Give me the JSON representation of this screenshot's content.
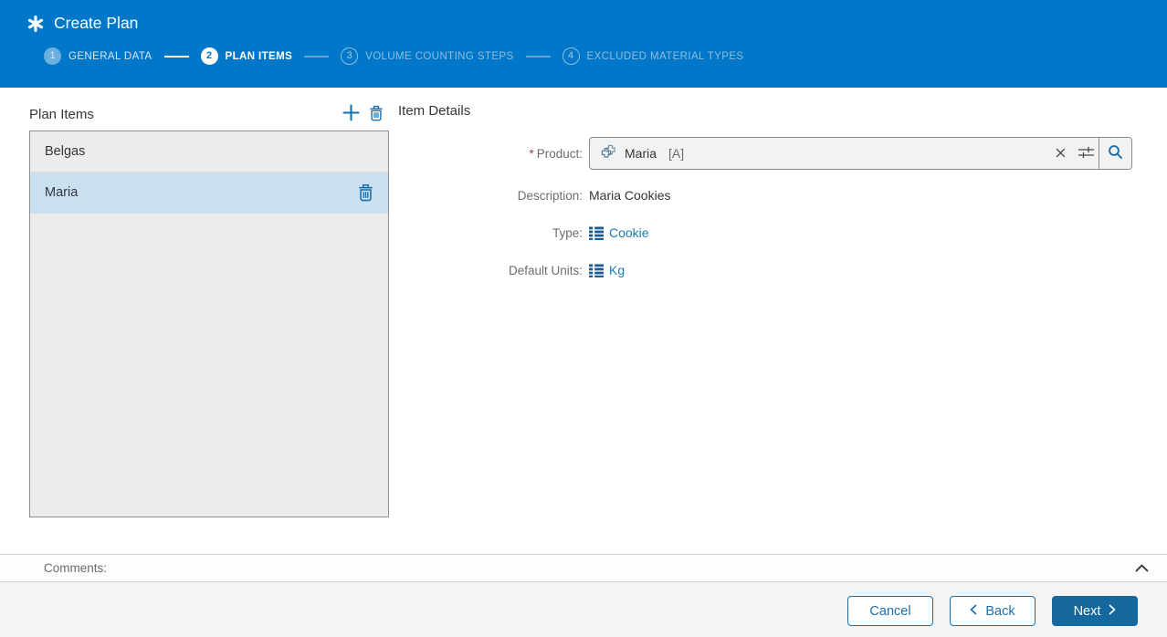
{
  "colors": {
    "header_blue": "#0077c8",
    "accent_blue": "#1b6ea9",
    "primary_button_blue": "#15689e",
    "link_blue": "#177ab7",
    "selected_row_blue": "#c9e0f1",
    "required_marker_red": "#a5433a"
  },
  "icons": {
    "app": "asterisk-icon",
    "add_item": "plus-icon",
    "delete_item": "trash-icon",
    "product_value": "product-cube-icon",
    "clear_value": "x-icon",
    "value_help_settings": "sliders-icon",
    "search": "magnifier-icon",
    "list_value": "list-icon",
    "collapse_comments": "chevron-up-icon",
    "back": "chevron-left-icon",
    "next": "chevron-right-icon"
  },
  "header": {
    "title": "Create Plan",
    "steps": [
      {
        "number": "1",
        "label": "GENERAL DATA",
        "state": "done"
      },
      {
        "number": "2",
        "label": "PLAN ITEMS",
        "state": "active"
      },
      {
        "number": "3",
        "label": "VOLUME COUNTING STEPS",
        "state": "upcoming"
      },
      {
        "number": "4",
        "label": "EXCLUDED MATERIAL TYPES",
        "state": "upcoming"
      }
    ]
  },
  "plan_items": {
    "title": "Plan Items",
    "items": [
      {
        "name": "Belgas"
      },
      {
        "name": "Maria"
      }
    ],
    "selected_item": "Maria"
  },
  "item_details": {
    "title": "Item Details",
    "product": {
      "label": "Product:",
      "required_marker": "*",
      "value": "Maria",
      "value_suffix": "[A]"
    },
    "description": {
      "label": "Description:",
      "value": "Maria Cookies"
    },
    "type": {
      "label": "Type:",
      "value": "Cookie"
    },
    "default_units": {
      "label": "Default Units:",
      "value": "Kg"
    }
  },
  "comments": {
    "label": "Comments:"
  },
  "footer": {
    "cancel": "Cancel",
    "back": "Back",
    "next": "Next"
  }
}
